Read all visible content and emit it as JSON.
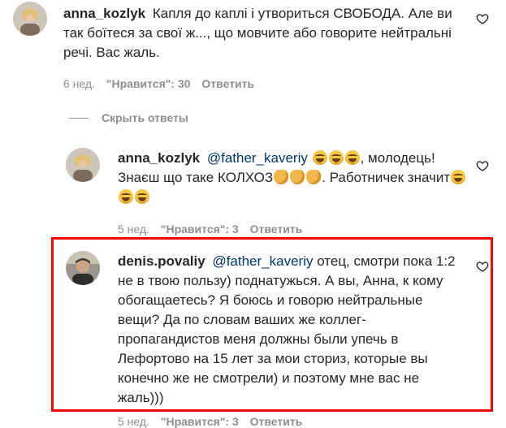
{
  "comment1": {
    "username": "anna_kozlyk",
    "text": "Капля до каплі і утвориться СВОБОДА. Але ви так боїтеся за свої ж..., що мовчите або говорите нейтральні речі. Вас жаль.",
    "time": "6 нед.",
    "likes": "\"Нравится\": 30",
    "reply": "Ответить"
  },
  "hide_replies": {
    "label": "Скрыть ответы"
  },
  "comment2": {
    "username": "anna_kozlyk",
    "mention": "@father_kaveriy",
    "text_part1": ", молодець! Знаєш що таке КОЛХОЗ",
    "text_part2": ". Работничек значит",
    "time": "5 нед.",
    "likes": "\"Нравится\": 3",
    "reply": "Ответить"
  },
  "comment3": {
    "username": "denis.povaliy",
    "mention": "@father_kaveriy",
    "text": " отец, смотри пока 1:2 не в твою пользу) поднатужься. А вы, Анна, к кому обогащаетесь? Я боюсь и говорю нейтральные вещи? Да по словам ваших же коллег-пропагандистов меня должны были упечь в Лефортово на 15 лет за мои сториз, которые вы конечно же не смотрели) и поэтому мне вас не жаль)))",
    "time": "5 нед.",
    "likes": "\"Нравится\": 3",
    "reply": "Ответить"
  },
  "colors": {
    "text": "#262626",
    "meta": "#8e8e8e",
    "mention": "#00376b",
    "highlight": "#ff0000"
  },
  "icons": {
    "like": "heart-icon",
    "laugh": "laughing-emoji-icon",
    "clap": "clapping-hands-emoji-icon"
  }
}
